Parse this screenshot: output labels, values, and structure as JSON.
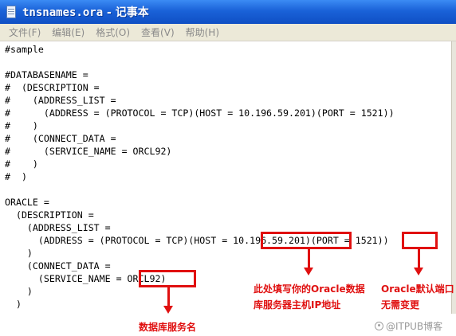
{
  "window": {
    "filename": "tnsnames.ora",
    "title_suffix": " - 记事本"
  },
  "menu": [
    "文件(F)",
    "编辑(E)",
    "格式(O)",
    "查看(V)",
    "帮助(H)"
  ],
  "lines": [
    "#sample",
    "",
    "#DATABASENAME =",
    "#  (DESCRIPTION =",
    "#    (ADDRESS_LIST =",
    "#      (ADDRESS = (PROTOCOL = TCP)(HOST = 10.196.59.201)(PORT = 1521))",
    "#    )",
    "#    (CONNECT_DATA =",
    "#      (SERVICE_NAME = ORCL92)",
    "#    )",
    "#  )",
    "",
    "ORACLE =",
    "  (DESCRIPTION =",
    "    (ADDRESS_LIST =",
    "      (ADDRESS = (PROTOCOL = TCP)(HOST = 10.196.59.201)(PORT = 1521))",
    "    )",
    "    (CONNECT_DATA =",
    "      (SERVICE_NAME = ORCL92)",
    "    )",
    "  )"
  ],
  "annotations": {
    "host_note": "此处填写你的Oracle数据\n库服务器主机IP地址",
    "port_note": "Oracle默认端口\n无需变更",
    "service_note": "数据库服务名",
    "highlight_color": "#e01010"
  },
  "watermark": "@ITPUB博客"
}
